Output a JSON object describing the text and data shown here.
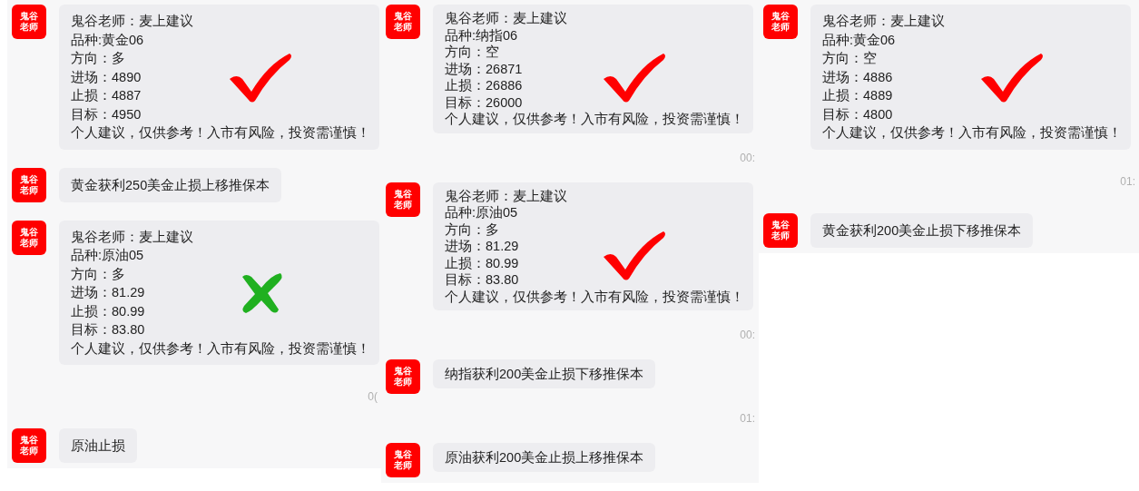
{
  "panels": [
    {
      "items": [
        {
          "kind": "card",
          "avatar": [
            "鬼谷",
            "老师"
          ],
          "lines": [
            "鬼谷老师：麦上建议",
            "品种:黄金06",
            "方向：多",
            "进场：4890",
            "止损：4887",
            "目标：4950",
            "个人建议，仅供参考！入市有风险，投资需谨慎！"
          ],
          "result": {
            "kind": "check"
          }
        },
        {
          "kind": "text",
          "avatar": [
            "鬼谷",
            "老师"
          ],
          "text": "黄金获利250美金止损上移推保本"
        },
        {
          "kind": "card",
          "avatar": [
            "鬼谷",
            "老师"
          ],
          "lines": [
            "鬼谷老师：麦上建议",
            "品种:原油05",
            "方向：多",
            "进场：81.29",
            "止损：80.99",
            "目标：83.80",
            "个人建议，仅供参考！入市有风险，投资需谨慎！"
          ],
          "result": {
            "kind": "cross"
          }
        },
        {
          "kind": "time",
          "text": "0("
        },
        {
          "kind": "text",
          "avatar": [
            "鬼谷",
            "老师"
          ],
          "text": "原油止损"
        }
      ]
    },
    {
      "items": [
        {
          "kind": "card",
          "avatar": [
            "鬼谷",
            "老师"
          ],
          "lines": [
            "鬼谷老师：麦上建议",
            "品种:纳指06",
            "方向：空",
            "进场：26871",
            "止损：26886",
            "目标：26000",
            "个人建议，仅供参考！入市有风险，投资需谨慎！"
          ],
          "result": {
            "kind": "check"
          }
        },
        {
          "kind": "time",
          "text": "00:"
        },
        {
          "kind": "card",
          "avatar": [
            "鬼谷",
            "老师"
          ],
          "lines": [
            "鬼谷老师：麦上建议",
            "品种:原油05",
            "方向：多",
            "进场：81.29",
            "止损：80.99",
            "目标：83.80",
            "个人建议，仅供参考！入市有风险，投资需谨慎！"
          ],
          "result": {
            "kind": "check"
          }
        },
        {
          "kind": "time",
          "text": "00:"
        },
        {
          "kind": "text",
          "avatar": [
            "鬼谷",
            "老师"
          ],
          "text": "纳指获利200美金止损下移推保本"
        },
        {
          "kind": "time",
          "text": "01:"
        },
        {
          "kind": "text",
          "avatar": [
            "鬼谷",
            "老师"
          ],
          "text": "原油获利200美金止损上移推保本"
        }
      ]
    },
    {
      "items": [
        {
          "kind": "card",
          "avatar": [
            "鬼谷",
            "老师"
          ],
          "lines": [
            "鬼谷老师：麦上建议",
            "品种:黄金06",
            "方向：空",
            "进场：4886",
            "止损：4889",
            "目标：4800",
            "个人建议，仅供参考！入市有风险，投资需谨慎！"
          ],
          "result": {
            "kind": "check"
          }
        },
        {
          "kind": "time",
          "text": "01:"
        },
        {
          "kind": "text",
          "avatar": [
            "鬼谷",
            "老师"
          ],
          "text": "黄金获利200美金止损下移推保本"
        }
      ]
    }
  ]
}
